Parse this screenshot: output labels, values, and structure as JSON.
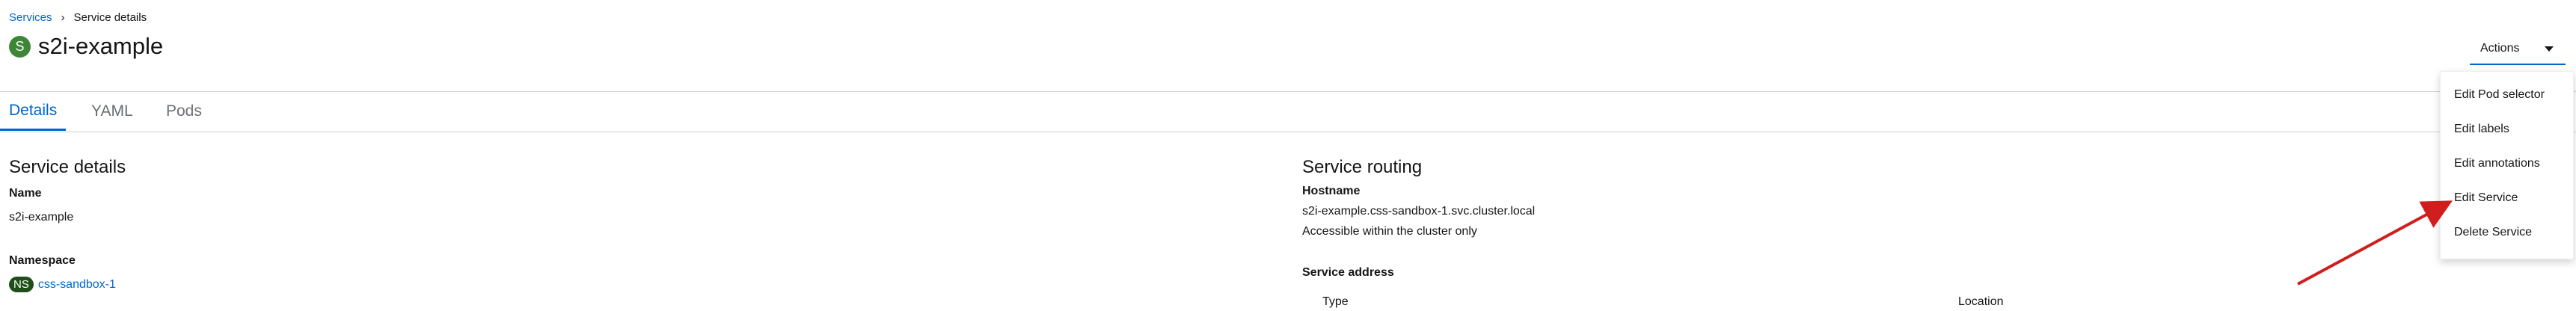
{
  "breadcrumb": {
    "parent": "Services",
    "separator": "›",
    "current": "Service details"
  },
  "header": {
    "badge": "S",
    "title": "s2i-example",
    "actions_label": "Actions"
  },
  "tabs": [
    {
      "label": "Details",
      "active": true
    },
    {
      "label": "YAML",
      "active": false
    },
    {
      "label": "Pods",
      "active": false
    }
  ],
  "details": {
    "section_title": "Service details",
    "name_label": "Name",
    "name_value": "s2i-example",
    "namespace_label": "Namespace",
    "namespace_badge": "NS",
    "namespace_value": "css-sandbox-1"
  },
  "routing": {
    "section_title": "Service routing",
    "hostname_label": "Hostname",
    "hostname_value": "s2i-example.css-sandbox-1.svc.cluster.local",
    "hostname_note": "Accessible within the cluster only",
    "address_label": "Service address",
    "columns": [
      "Type",
      "Location"
    ]
  },
  "actions_menu": {
    "items": [
      "Edit Pod selector",
      "Edit labels",
      "Edit annotations",
      "Edit Service",
      "Delete Service"
    ]
  },
  "colors": {
    "accent": "#0066cc",
    "badge_green": "#3e8635",
    "ns_badge": "#1e4f18",
    "arrow": "#d01e1e"
  }
}
